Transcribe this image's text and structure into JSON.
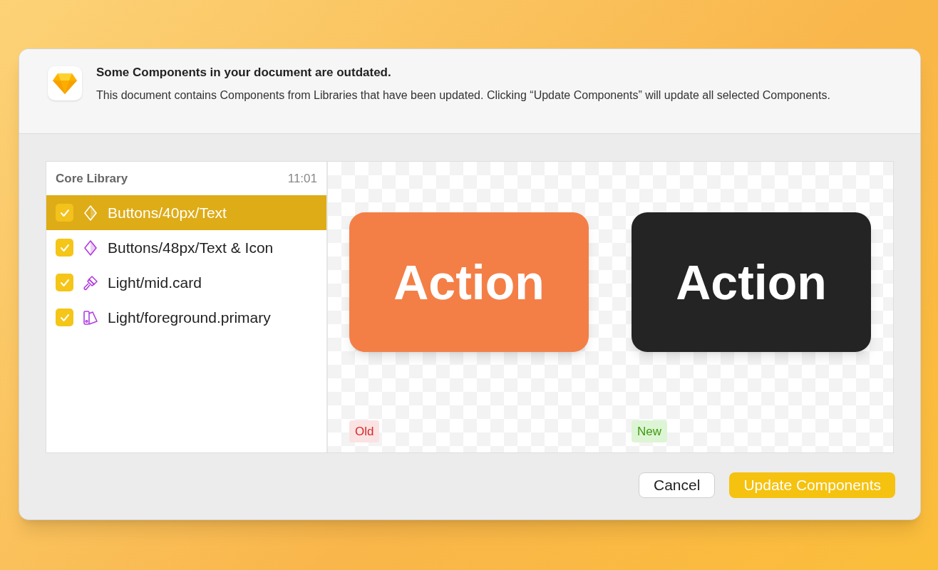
{
  "alert": {
    "title": "Some Components in your document are outdated.",
    "message": "This document contains Components from Libraries that have been updated. Clicking “Update Components” will update all selected Components."
  },
  "library": {
    "name": "Core Library",
    "time": "11:01",
    "items": [
      {
        "label": "Buttons/40px/Text",
        "kind": "symbol",
        "checked": true,
        "selected": true
      },
      {
        "label": "Buttons/48px/Text & Icon",
        "kind": "symbol",
        "checked": true,
        "selected": false
      },
      {
        "label": "Light/mid.card",
        "kind": "layer-style",
        "checked": true,
        "selected": false
      },
      {
        "label": "Light/foreground.primary",
        "kind": "color",
        "checked": true,
        "selected": false
      }
    ]
  },
  "previews": [
    {
      "text": "Action",
      "color": "#f37f47",
      "badge": "Old",
      "kind": "old"
    },
    {
      "text": "Action",
      "color": "#242424",
      "badge": "New",
      "kind": "new"
    }
  ],
  "buttons": [
    {
      "label": "Cancel",
      "kind": "secondary"
    },
    {
      "label": "Update Components",
      "kind": "primary"
    }
  ]
}
